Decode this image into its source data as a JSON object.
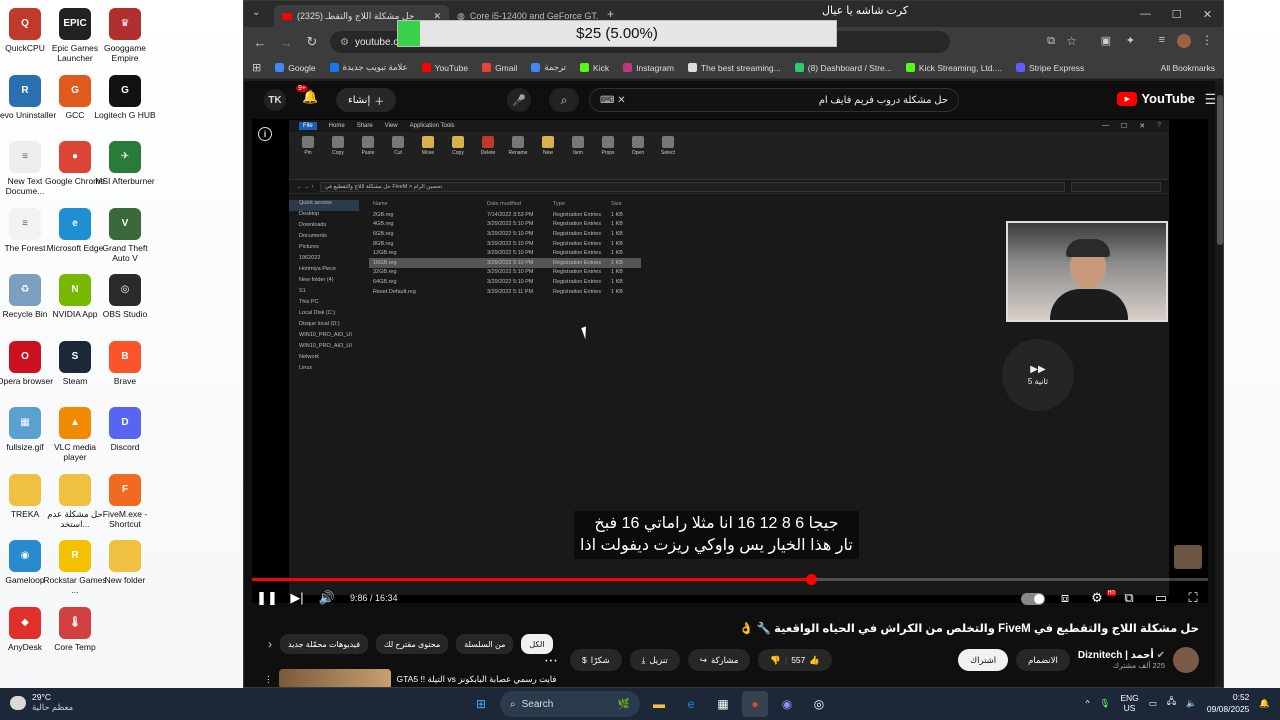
{
  "desktop_icons": [
    {
      "label": "QuickCPU",
      "color": "#c0392b",
      "glyph": "Q"
    },
    {
      "label": "Epic Games Launcher",
      "color": "#222222",
      "glyph": "EPIC"
    },
    {
      "label": "Googgame Empire",
      "color": "#b03030",
      "glyph": "♛"
    },
    {
      "label": "Revo Uninstaller",
      "color": "#2a6fb0",
      "glyph": "R"
    },
    {
      "label": "GCC",
      "color": "#e05a20",
      "glyph": "G"
    },
    {
      "label": "Logitech G HUB",
      "color": "#111111",
      "glyph": "G"
    },
    {
      "label": "New Text Docume...",
      "color": "#eeeeee",
      "glyph": "≡"
    },
    {
      "label": "Google Chrome",
      "color": "#db4437",
      "glyph": "●"
    },
    {
      "label": "MSI Afterburner",
      "color": "#2a7a3a",
      "glyph": "✈"
    },
    {
      "label": "The Forest",
      "color": "#f2f2f2",
      "glyph": "≡"
    },
    {
      "label": "Microsoft Edge",
      "color": "#1e8fd0",
      "glyph": "e"
    },
    {
      "label": "Grand Theft Auto V",
      "color": "#3a6a3a",
      "glyph": "V"
    },
    {
      "label": "Recycle Bin",
      "color": "#7a9fbf",
      "glyph": "♻"
    },
    {
      "label": "NVIDIA App",
      "color": "#76b900",
      "glyph": "N"
    },
    {
      "label": "OBS Studio",
      "color": "#2a2a2a",
      "glyph": "◎"
    },
    {
      "label": "Opera browser",
      "color": "#cc1020",
      "glyph": "O"
    },
    {
      "label": "Steam",
      "color": "#1b2838",
      "glyph": "S"
    },
    {
      "label": "Brave",
      "color": "#fb542b",
      "glyph": "B"
    },
    {
      "label": "fullsize.gif",
      "color": "#5aa0d0",
      "glyph": "▦"
    },
    {
      "label": "VLC media player",
      "color": "#f08a00",
      "glyph": "▲"
    },
    {
      "label": "Discord",
      "color": "#5865f2",
      "glyph": "D"
    },
    {
      "label": "TREKA",
      "color": "#f0c040",
      "glyph": ""
    },
    {
      "label": "حل مشكلة عدم استخد...",
      "color": "#f0c040",
      "glyph": ""
    },
    {
      "label": "FiveM.exe - Shortcut",
      "color": "#f06a20",
      "glyph": "F"
    },
    {
      "label": "Gameloop",
      "color": "#2a8ad0",
      "glyph": "◉"
    },
    {
      "label": "Rockstar Games ...",
      "color": "#f2c200",
      "glyph": "R"
    },
    {
      "label": "New folder",
      "color": "#f0c040",
      "glyph": ""
    },
    {
      "label": "AnyDesk",
      "color": "#e0302a",
      "glyph": "◆"
    },
    {
      "label": "Core Temp",
      "color": "#d04040",
      "glyph": "🌡"
    }
  ],
  "browser": {
    "tabs": [
      {
        "title": "حل مشكلة اللاج والتقطـ (2325)",
        "favicon_color": "#ff0000"
      },
      {
        "title": "Core i5-12400 and GeForce GT...",
        "favicon_color": "#888888"
      }
    ],
    "url": "youtube.com",
    "bookmarks": [
      {
        "label": "Google",
        "color": "#4285f4"
      },
      {
        "label": "علامة تبويب جديدة",
        "color": "#1877f2"
      },
      {
        "label": "YouTube",
        "color": "#ff0000"
      },
      {
        "label": "Gmail",
        "color": "#ea4335"
      },
      {
        "label": "ترجمة",
        "color": "#4285f4"
      },
      {
        "label": "Kick",
        "color": "#53fc18"
      },
      {
        "label": "Instagram",
        "color": "#c13584"
      },
      {
        "label": "The best streaming...",
        "color": "#dddddd"
      },
      {
        "label": "(8) Dashboard / Stre...",
        "color": "#2ecc71"
      },
      {
        "label": "Kick Streaming, Ltd....",
        "color": "#53fc18"
      },
      {
        "label": "Stripe Express",
        "color": "#635bff"
      }
    ],
    "all_bookmarks": "All Bookmarks"
  },
  "donation": {
    "title": "كرت شاشه يا عيال",
    "amount": "$25 (5.00%)",
    "progress": 0.05
  },
  "youtube": {
    "logo": "YouTube",
    "search_query": "حل مشكلة دروب فريم فايف ام",
    "create_label": "إنشاء",
    "notif_count": "9+",
    "subtitle_line1": "جيجا 6 8 12 16 انا مثلا راماتي 16 فبخ",
    "subtitle_line2": "تار هذا الخيار يس واوكي ريزت ديفولت اذا",
    "skip_label": "5 ثانية",
    "time_current": "9:86",
    "time_total": "16:34",
    "progress": 0.585,
    "video_title": "حل مشكلة اللاج والتقطيع في FiveM والتخلص من الكراش في الحياه الواقعية 🔧 👌",
    "channel_name": "أحمد | Diznitech",
    "channel_subs": "225 ألف مشترك",
    "join_label": "الانضمام",
    "subscribe_label": "اشتراك",
    "likes": "557",
    "share_label": "مشاركة",
    "download_label": "تنزيل",
    "thanks_label": "شكرًا",
    "chips": [
      "الكل",
      "من السلسلة",
      "محتوى مقترح لك",
      "فيديوهات محمّلة جديد"
    ],
    "rec_title": "فايت رسمي عصابة البابكونز vs التيلة !! GTA5"
  },
  "explorer": {
    "ribbon_tabs": [
      "File",
      "Home",
      "Share",
      "View",
      "Application Tools"
    ],
    "path": "حل مشكلة اللاج والتقطيع في FiveM > تحسين الرام",
    "columns": [
      "Name",
      "Date modified",
      "Type",
      "Size"
    ],
    "files": [
      {
        "name": "2GB.reg",
        "date": "7/14/2022 3:53 PM",
        "type": "Registration Entries",
        "size": "1 KB"
      },
      {
        "name": "4GB.reg",
        "date": "3/29/2022 5:10 PM",
        "type": "Registration Entries",
        "size": "1 KB"
      },
      {
        "name": "6GB.reg",
        "date": "3/29/2022 5:10 PM",
        "type": "Registration Entries",
        "size": "1 KB"
      },
      {
        "name": "8GB.reg",
        "date": "3/29/2022 5:10 PM",
        "type": "Registration Entries",
        "size": "1 KB"
      },
      {
        "name": "12GB.reg",
        "date": "3/29/2022 5:10 PM",
        "type": "Registration Entries",
        "size": "1 KB"
      },
      {
        "name": "16GB.reg",
        "date": "3/29/2022 5:10 PM",
        "type": "Registration Entries",
        "size": "1 KB"
      },
      {
        "name": "32GB.reg",
        "date": "3/29/2022 5:10 PM",
        "type": "Registration Entries",
        "size": "1 KB"
      },
      {
        "name": "64GB.reg",
        "date": "3/29/2022 5:10 PM",
        "type": "Registration Entries",
        "size": "1 KB"
      },
      {
        "name": "Reset Default.reg",
        "date": "3/29/2022 5:11 PM",
        "type": "Registration Entries",
        "size": "1 KB"
      }
    ],
    "selected_index": 5,
    "nav": [
      "Quick access",
      "Desktop",
      "Downloads",
      "Documents",
      "Pictures",
      "1962022",
      "Horimiya Piece",
      "New folder (4)",
      "S1",
      "This PC",
      "Local Disk (C:)",
      "Disque local (D:)",
      "WIN10_PRO_AIO_UI",
      "WIN10_PRO_AIO_UI",
      "Network",
      "Linux"
    ]
  },
  "taskbar": {
    "temp": "29°C",
    "weather": "معظم حالية",
    "search_label": "Search",
    "lang1": "ENG",
    "lang2": "US",
    "time": "0:52",
    "date": "09/08/2025"
  }
}
